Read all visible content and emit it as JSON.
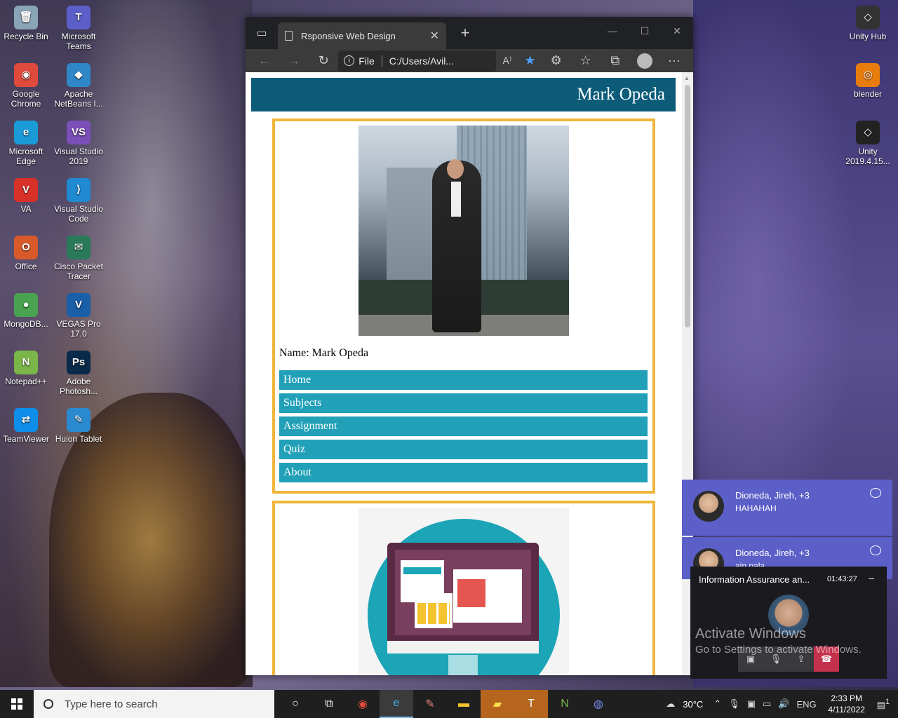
{
  "desktop": {
    "icons_left": [
      {
        "label": "Recycle Bin",
        "glyph": "🗑",
        "color": "#8aa4b8"
      },
      {
        "label": "Microsoft Teams",
        "glyph": "T",
        "color": "#5b5fc7"
      },
      {
        "label": "Google Chrome",
        "glyph": "◉",
        "color": "#e04a3c"
      },
      {
        "label": "Apache NetBeans I...",
        "glyph": "◆",
        "color": "#2f87c7"
      },
      {
        "label": "Microsoft Edge",
        "glyph": "e",
        "color": "#1a9bd7"
      },
      {
        "label": "Visual Studio 2019",
        "glyph": "VS",
        "color": "#7b4fb8"
      },
      {
        "label": "VA",
        "glyph": "V",
        "color": "#d8312a"
      },
      {
        "label": "Visual Studio Code",
        "glyph": "⟩",
        "color": "#1f8ad2"
      },
      {
        "label": "Office",
        "glyph": "O",
        "color": "#d85a2a"
      },
      {
        "label": "Cisco Packet Tracer",
        "glyph": "✉",
        "color": "#2a7a5a"
      },
      {
        "label": "MongoDB...",
        "glyph": "●",
        "color": "#4aa350"
      },
      {
        "label": "VEGAS Pro 17.0",
        "glyph": "V",
        "color": "#1a5fa8"
      },
      {
        "label": "Notepad++",
        "glyph": "N",
        "color": "#7ab648"
      },
      {
        "label": "Adobe Photosh...",
        "glyph": "Ps",
        "color": "#0a2a4a"
      },
      {
        "label": "TeamViewer",
        "glyph": "⇄",
        "color": "#0e8ee9"
      },
      {
        "label": "Huion Tablet",
        "glyph": "✎",
        "color": "#2a8ad0"
      }
    ],
    "icons_right": [
      {
        "label": "Unity Hub",
        "glyph": "◇",
        "color": "#333333"
      },
      {
        "label": "blender",
        "glyph": "◎",
        "color": "#e87d0d"
      },
      {
        "label": "Unity 2019.4.15...",
        "glyph": "◇",
        "color": "#222222"
      }
    ]
  },
  "browser": {
    "tab_title": "Rsponsive Web Design",
    "address_scheme": "File",
    "address_path": "C:/Users/Avil...",
    "colors": {
      "header_bg": "#0c5b79",
      "nav_bg": "#21a0b8",
      "card_border": "#f0b63a"
    }
  },
  "page": {
    "header_title": "Mark Opeda",
    "name_line": "Name: Mark Opeda",
    "nav": [
      "Home",
      "Subjects",
      "Assignment",
      "Quiz",
      "About"
    ]
  },
  "teams": {
    "notifications": [
      {
        "who": "Dioneda, Jireh, +3",
        "msg": "HAHAHAH"
      },
      {
        "who": "Dioneda, Jireh, +3",
        "msg": "ain pala"
      }
    ],
    "call": {
      "title": "Information Assurance an...",
      "time": "01:43:27",
      "minimize": "–"
    }
  },
  "watermark": {
    "line1": "Activate Windows",
    "line2": "Go to Settings to activate Windows."
  },
  "taskbar": {
    "search_placeholder": "Type here to search",
    "temperature": "30°C",
    "language": "ENG",
    "time": "2:33 PM",
    "date": "4/11/2022",
    "notification_count": "1"
  }
}
